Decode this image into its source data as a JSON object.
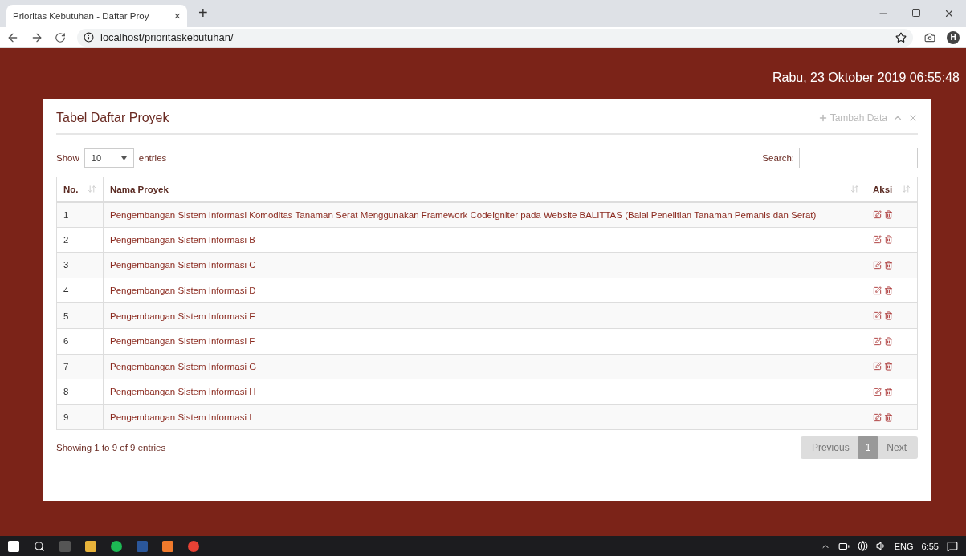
{
  "browser": {
    "tab_title": "Prioritas Kebutuhan - Daftar Proy",
    "tab_close": "×",
    "new_tab": "+",
    "url": "localhost/prioritaskebutuhan/",
    "profile_initial": "H"
  },
  "header": {
    "datetime": "Rabu, 23 Oktober 2019 06:55:48"
  },
  "panel": {
    "title": "Tabel Daftar Proyek",
    "add_button": "Tambah Data"
  },
  "table_controls": {
    "show_label": "Show",
    "entries_value": "10",
    "entries_label": "entries",
    "search_label": "Search:"
  },
  "table": {
    "columns": [
      "No.",
      "Nama Proyek",
      "Aksi"
    ],
    "rows": [
      {
        "no": "1",
        "name": "Pengembangan Sistem Informasi Komoditas Tanaman Serat Menggunakan Framework CodeIgniter pada Website BALITTAS (Balai Penelitian Tanaman Pemanis dan Serat)"
      },
      {
        "no": "2",
        "name": "Pengembangan Sistem Informasi B"
      },
      {
        "no": "3",
        "name": "Pengembangan Sistem Informasi C"
      },
      {
        "no": "4",
        "name": "Pengembangan Sistem Informasi D"
      },
      {
        "no": "5",
        "name": "Pengembangan Sistem Informasi E"
      },
      {
        "no": "6",
        "name": "Pengembangan Sistem Informasi F"
      },
      {
        "no": "7",
        "name": "Pengembangan Sistem Informasi G"
      },
      {
        "no": "8",
        "name": "Pengembangan Sistem Informasi H"
      },
      {
        "no": "9",
        "name": "Pengembangan Sistem Informasi I"
      }
    ]
  },
  "footer": {
    "info": "Showing 1 to 9 of 9 entries",
    "pagination": [
      {
        "label": "Previous",
        "selected": false
      },
      {
        "label": "1",
        "selected": true
      },
      {
        "label": "Next",
        "selected": false
      }
    ]
  },
  "taskbar": {
    "language": "ENG",
    "time": "6:55"
  }
}
